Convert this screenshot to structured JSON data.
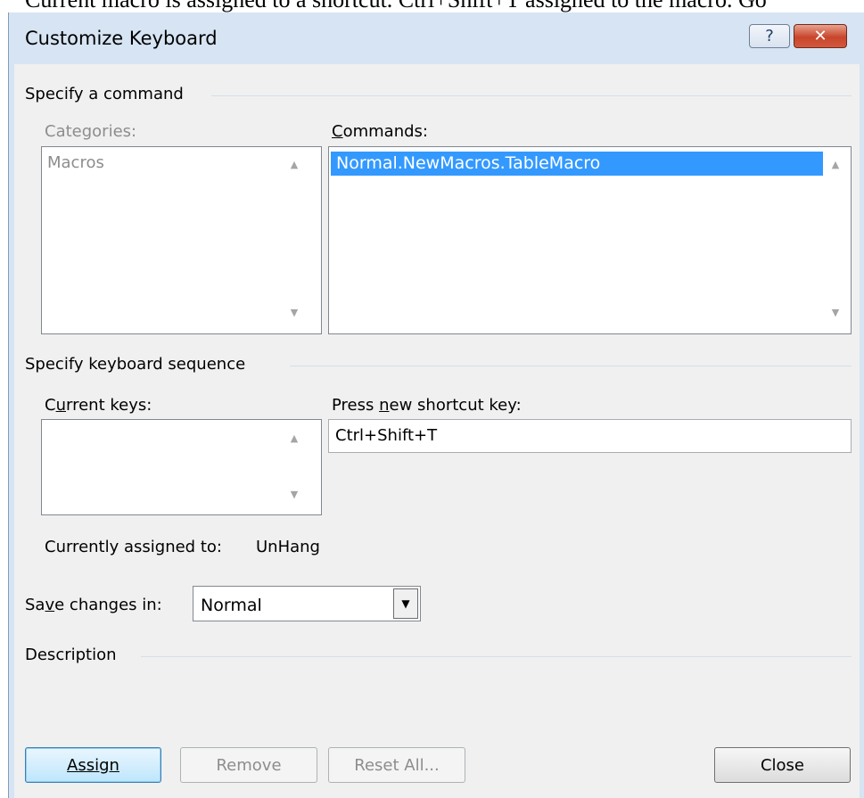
{
  "background": {
    "partial_text": "Current macro is assigned to a shortcut. Ctrl+Shift+T assigned to the macro. Go"
  },
  "window": {
    "title": "Customize Keyboard",
    "help_icon": "?",
    "close_icon": "✕"
  },
  "command_section": {
    "title": "Specify a command",
    "categories_label": "Categories:",
    "categories_items": [
      "Macros"
    ],
    "commands_label": "Commands:",
    "commands_items": [
      "Normal.NewMacros.TableMacro"
    ]
  },
  "keyboard_section": {
    "title": "Specify keyboard sequence",
    "current_keys_label": "Current keys:",
    "current_keys_items": [],
    "new_shortcut_label": "Press new shortcut key:",
    "new_shortcut_value": "Ctrl+Shift+T",
    "assigned_label": "Currently assigned to:",
    "assigned_value": "UnHang"
  },
  "save": {
    "label": "Save changes in:",
    "value": "Normal"
  },
  "description": {
    "title": "Description",
    "text": ""
  },
  "buttons": {
    "assign": "Assign",
    "remove": "Remove",
    "reset_all": "Reset All...",
    "close": "Close"
  },
  "icons": {
    "scroll_up": "▲",
    "scroll_down": "▼",
    "dropdown": "▼"
  },
  "colors": {
    "selection": "#3399ff",
    "titlebar": "#d6e4f3",
    "client": "#f0f0f0",
    "close_button": "#c8452b"
  }
}
